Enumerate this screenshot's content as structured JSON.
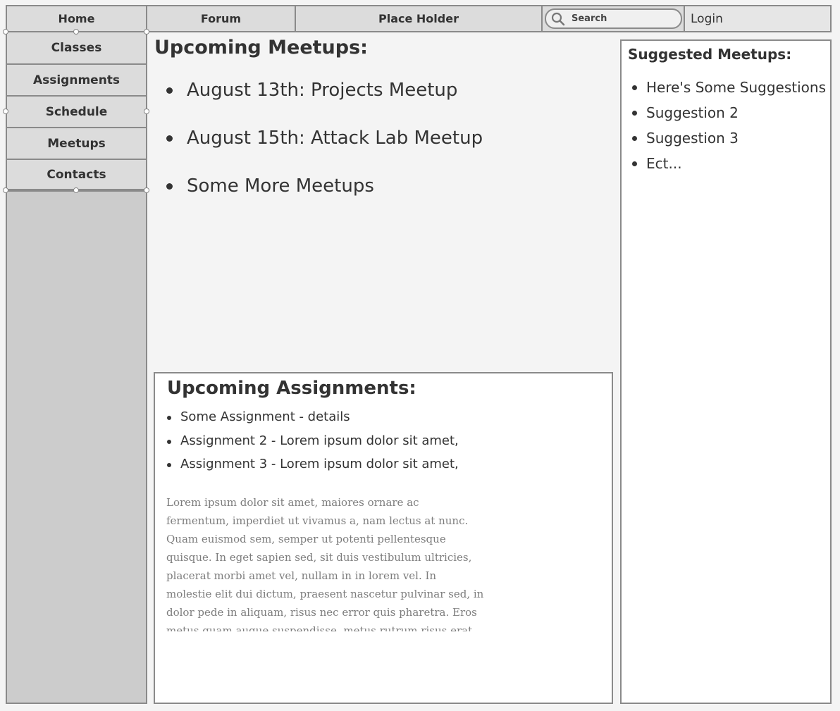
{
  "nav": {
    "home": "Home",
    "forum": "Forum",
    "placeholder": "Place Holder",
    "search_placeholder": "Search",
    "login": "Login"
  },
  "sidebar": {
    "items": [
      {
        "label": "Classes"
      },
      {
        "label": "Assignments"
      },
      {
        "label": "Schedule"
      },
      {
        "label": "Meetups"
      },
      {
        "label": "Contacts"
      }
    ]
  },
  "meetups": {
    "title": "Upcoming Meetups:",
    "items": [
      "August 13th: Projects Meetup",
      "August 15th: Attack Lab Meetup",
      "Some More Meetups"
    ]
  },
  "assignments": {
    "title": "Upcoming Assignments:",
    "items": [
      "Some Assignment - details",
      "Assignment 2 - Lorem ipsum dolor sit amet,",
      "Assignment 3 - Lorem ipsum dolor sit amet,"
    ],
    "body": "Lorem ipsum dolor sit amet, maiores ornare ac fermentum, imperdiet ut vivamus a, nam lectus at nunc. Quam euismod sem, semper ut potenti pellentesque quisque. In eget sapien sed, sit duis vestibulum ultricies, placerat morbi amet vel, nullam in in lorem vel. In molestie elit dui dictum, praesent nascetur pulvinar sed, in dolor pede in aliquam, risus nec error quis pharetra. Eros metus quam augue suspendisse, metus rutrum risus erat in.  In ultrices quo ut lectus, etiam"
  },
  "suggested": {
    "title": "Suggested Meetups:",
    "items": [
      "Here's Some Suggestions",
      "Suggestion 2",
      "Suggestion 3",
      "Ect..."
    ]
  }
}
